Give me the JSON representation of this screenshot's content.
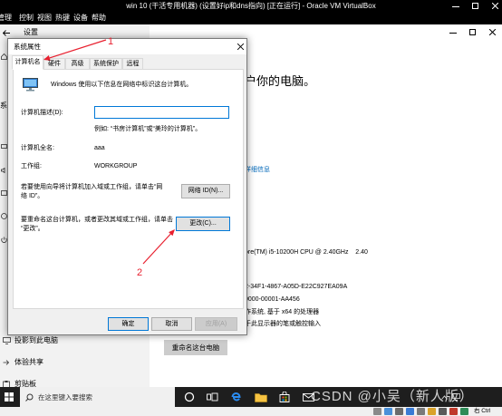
{
  "vbox": {
    "title": "win 10 (干活专用机器) (设置好ip和dns指向) [正在运行] - Oracle VM VirtualBox",
    "menu": [
      "管理",
      "控制",
      "视图",
      "热键",
      "设备",
      "帮助"
    ],
    "host_key": "右 Ctrl"
  },
  "settings": {
    "title": "设置",
    "sidebar_partial_label": "系",
    "sidebar_items": [
      "投影到此电脑",
      "体验共享",
      "剪贴板"
    ],
    "heading_partial": "户你的电脑。",
    "details_link_partial": "详细信息",
    "spec_lines": [
      "ore(TM) i5-10200H CPU @ 2.40GHz    2.40",
      "2-34F1-4867-A05D-E22C927EA09A",
      "0000-00001-AA456",
      "作系统, 基于 x64 的处理器",
      "于此显示器的笔或触控输入"
    ],
    "rename_button": "重命名这台电脑"
  },
  "dialog": {
    "title": "系统属性",
    "tabs": [
      "计算机名",
      "硬件",
      "高级",
      "系统保护",
      "远程"
    ],
    "selected_tab_index": 0,
    "intro": "Windows 使用以下信息在网络中标识这台计算机。",
    "description_label": "计算机描述(D):",
    "description_value": "",
    "example": "例如: “书房计算机”或“美玲的计算机”。",
    "full_name_label": "计算机全名:",
    "full_name": "aaa",
    "workgroup_label": "工作组:",
    "workgroup": "WORKGROUP",
    "network_id_lines": [
      "若要使用向导将计算机加入域或工作组，请单击“网",
      "络 ID”。"
    ],
    "network_id_button": "网络 ID(N)...",
    "rename_lines": [
      "要重命名这台计算机，或者更改其域或工作组，请单击",
      "“更改”。"
    ],
    "change_button": "更改(C)...",
    "ok_button": "确定",
    "cancel_button": "取消",
    "apply_button": "应用(A)"
  },
  "annotations": [
    "1",
    "2"
  ],
  "taskbar": {
    "search_placeholder": "在这里键入要搜索",
    "watermark": "CSDN @小吴（新人版）",
    "icons": [
      "windows-start-icon",
      "search-icon",
      "cortana-icon",
      "task-view-icon",
      "edge-icon",
      "file-explorer-icon",
      "store-icon",
      "mail-icon"
    ]
  },
  "colors": {
    "annotation": "#e8202f",
    "accent": "#0078d7",
    "link": "#0067b8",
    "taskbar": "#1e1e1e"
  }
}
